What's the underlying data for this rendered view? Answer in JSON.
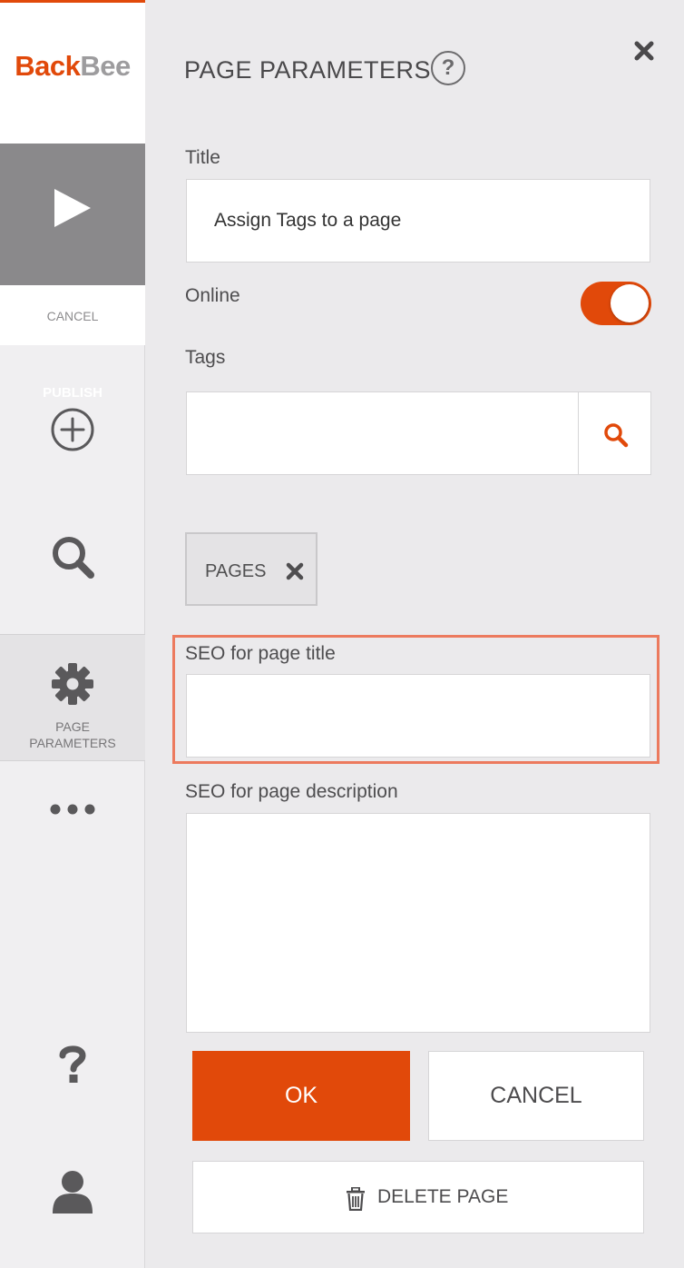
{
  "brand": {
    "part1": "Back",
    "part2": "Bee",
    "accent": "#e1490a"
  },
  "sidebar": {
    "publish_label": "PUBLISH",
    "cancel_label": "CANCEL",
    "params_line1": "PAGE",
    "params_line2": "PARAMETERS",
    "icons": [
      "play-icon",
      "add-circle-icon",
      "search-icon",
      "gear-icon",
      "more-dots-icon",
      "help-icon",
      "user-icon"
    ]
  },
  "panel": {
    "title": "PAGE PARAMETERS",
    "help_glyph": "?"
  },
  "form": {
    "title_label": "Title",
    "title_value": "Assign Tags to a page",
    "online_label": "Online",
    "online_state": true,
    "tags_label": "Tags",
    "tags_value": "",
    "tag_chips": [
      {
        "label": "PAGES"
      }
    ],
    "seo_title_label": "SEO for page title",
    "seo_title_value": "",
    "seo_desc_label": "SEO for page description",
    "seo_desc_value": ""
  },
  "actions": {
    "ok_label": "OK",
    "cancel_label": "CANCEL",
    "delete_label": "DELETE PAGE"
  }
}
